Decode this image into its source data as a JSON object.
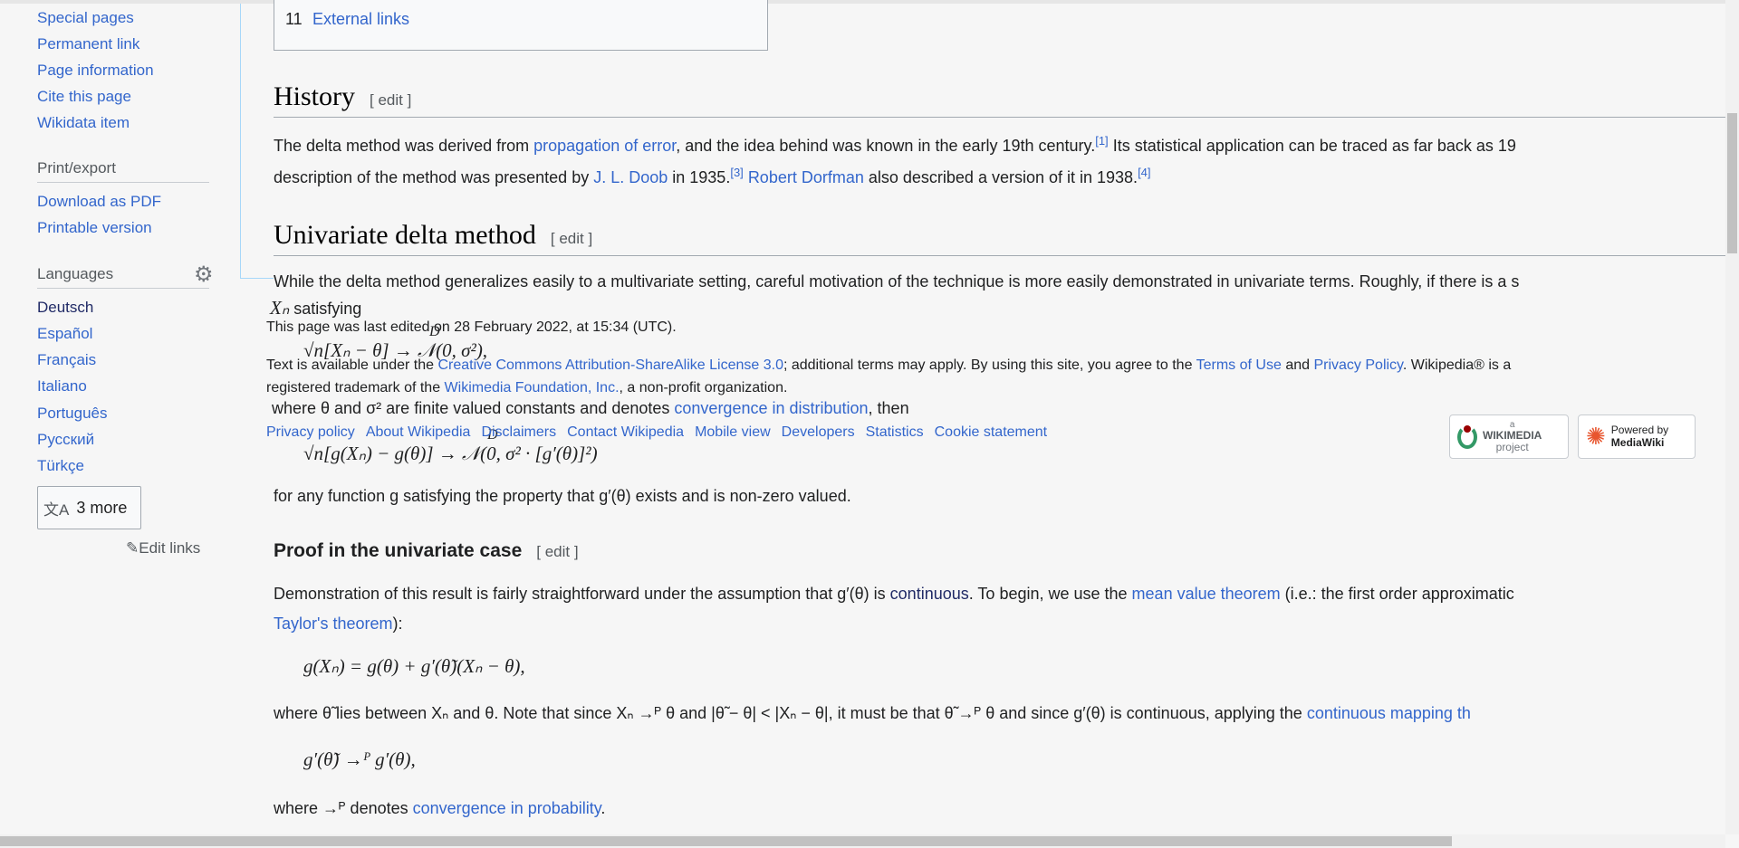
{
  "sidebar": {
    "tools": [
      "Special pages",
      "Permanent link",
      "Page information",
      "Cite this page",
      "Wikidata item"
    ],
    "print_heading": "Print/export",
    "print": [
      "Download as PDF",
      "Printable version"
    ],
    "languages_heading": "Languages",
    "languages": [
      "Deutsch",
      "Español",
      "Français",
      "Italiano",
      "Português",
      "Русский",
      "Türkçe"
    ],
    "more_languages": "3 more",
    "edit_links": "Edit links"
  },
  "toc": {
    "item_number": "11",
    "item_label": "External links"
  },
  "history": {
    "title": "History",
    "edit": "[ edit ]",
    "p1a": "The delta method was derived from ",
    "p1link": "propagation of error",
    "p1b": ", and the idea behind was known in the early 19th century.",
    "ref1": "[1]",
    "p1c": " Its statistical application can be traced as far back as 19",
    "p2a": "description of the method was presented by ",
    "p2link": "J. L. Doob",
    "p2b": " in 1935.",
    "ref3": "[3]",
    "p2link2": "Robert Dorfman",
    "p2c": " also described a version of it in 1938.",
    "ref4": "[4]"
  },
  "univariate": {
    "title": "Univariate delta method",
    "edit": "[ edit ]",
    "p1": "While the delta method generalizes easily to a multivariate setting, careful motivation of the technique is more easily demonstrated in univariate terms. Roughly, if there is a s",
    "xn": "Xₙ",
    "satisfying": " satisfying",
    "eq1": "√n[Xₙ − θ] → 𝒩(0, σ²),",
    "eq1_over": "D",
    "where_a": "where θ and σ² are finite valued constants and ",
    "arrow": "⟶",
    "where_b": " denotes ",
    "where_link": "convergence in distribution",
    "where_c": ", then",
    "eq2": "√n[g(Xₙ) − g(θ)] → 𝒩(0, σ² · [g′(θ)]²)",
    "eq2_over": "D",
    "p_after": "for any function g satisfying the property that g′(θ) exists and is non-zero valued."
  },
  "proof": {
    "title": "Proof in the univariate case",
    "edit": "[ edit ]",
    "p1a": "Demonstration of this result is fairly straightforward under the assumption that g′(θ) is ",
    "p1link": "continuous",
    "p1b": ". To begin, we use the ",
    "p1link2": "mean value theorem",
    "p1c": " (i.e.: the first order approximatic",
    "p2link": "Taylor's theorem",
    "p2b": "):",
    "eq1": "g(Xₙ) = g(θ) + g′(θ̃)(Xₙ − θ),",
    "l3": "where θ̃ lies between Xₙ and θ. Note that since Xₙ →ᴾ θ and |θ̃ − θ| < |Xₙ − θ|, it must be that θ̃ →ᴾ θ and since g′(θ) is continuous, applying the ",
    "l3link": "continuous mapping th",
    "eq2": "g′(θ̃) →ᴾ g′(θ),",
    "l5a": "where →ᴾ denotes ",
    "l5link": "convergence in probability",
    "l5b": "."
  },
  "footer": {
    "last_edited": "This page was last edited on 28 February 2022, at 15:34 (UTC).",
    "license_a": "Text is available under the ",
    "license_link": "Creative Commons Attribution-ShareAlike License 3.0",
    "license_b": "; additional terms may apply. By using this site, you agree to the ",
    "terms": "Terms of Use",
    "and": " and ",
    "privacy": "Privacy Policy",
    "license_c": ". Wikipedia® is a",
    "tm_a": "registered trademark of the ",
    "tm_link": "Wikimedia Foundation, Inc.",
    "tm_b": ", a non-profit organization.",
    "links": [
      "Privacy policy",
      "About Wikipedia",
      "Disclaimers",
      "Contact Wikipedia",
      "Mobile view",
      "Developers",
      "Statistics",
      "Cookie statement"
    ],
    "wikimedia_badge": {
      "small": "a",
      "name": "WIKIMEDIA",
      "sub": "project"
    },
    "mediawiki_badge": {
      "line1": "Powered by",
      "line2": "MediaWiki"
    }
  }
}
